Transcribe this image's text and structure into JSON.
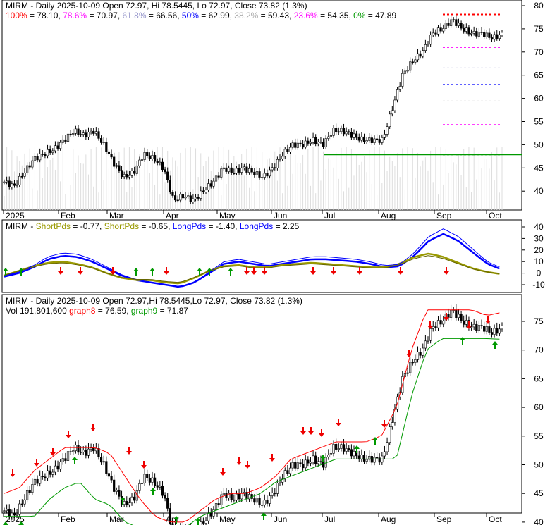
{
  "panel1": {
    "title": "MIRM - Daily 2025-10-09 Open 72.97, Hi 78.5445, Lo 72.97, Close 73.82 (1.3%)",
    "fibs": [
      {
        "label": "100%",
        "value": "78.10",
        "num": 78.1,
        "color": "#ff0000"
      },
      {
        "label": "78.6%",
        "value": "70.97",
        "num": 70.97,
        "color": "#ff00ff"
      },
      {
        "label": "61.8%",
        "value": "66.56",
        "num": 66.56,
        "color": "#9999cc"
      },
      {
        "label": "50%",
        "value": "62.99",
        "num": 62.99,
        "color": "#0000ff"
      },
      {
        "label": "38.2%",
        "value": "59.43",
        "num": 59.43,
        "color": "#aaaaaa"
      },
      {
        "label": "23.6%",
        "value": "54.35",
        "num": 54.35,
        "color": "#ff00ff"
      },
      {
        "label": "0%",
        "value": "47.89",
        "num": 47.89,
        "color": "#009900"
      }
    ]
  },
  "panel2": {
    "prefix": "MIRM - ",
    "items": [
      {
        "label": "ShortPds",
        "value": "-0.77",
        "color": "#999900"
      },
      {
        "label": "ShortPds",
        "value": "-0.65",
        "color": "#999900"
      },
      {
        "label": "LongPds",
        "value": "-1.40",
        "color": "#0000ff"
      },
      {
        "label": "LongPds",
        "value": "2.25",
        "color": "#0000ff"
      }
    ]
  },
  "panel3": {
    "title": "MIRM - Daily 2025-10-09 Open 72.97,Hi 78.5445,Lo 72.97, Close 73.82 (1.3%)",
    "vol": "Vol 191,801,600",
    "graph8_label": "graph8",
    "graph8_value": "76.59",
    "graph9_label": "graph9",
    "graph9_value": "71.87"
  },
  "chart_data": {
    "type": "candlestick",
    "x_ticks": [
      "2025",
      "Feb",
      "Mar",
      "Apr",
      "May",
      "Jun",
      "Jul",
      "Aug",
      "Sep",
      "Oct"
    ],
    "y_ticks_price": [
      40,
      45,
      50,
      55,
      60,
      65,
      70,
      75,
      80
    ],
    "y_ticks_osc": [
      -10,
      0,
      10,
      20,
      30,
      40
    ],
    "y_ticks_p3": [
      40,
      45,
      50,
      55,
      60,
      65,
      70,
      75
    ],
    "weekly_close": [
      42,
      41,
      44,
      47,
      48,
      49,
      51,
      53,
      52,
      53,
      50,
      46,
      43,
      44,
      48,
      47,
      45,
      38,
      39,
      38,
      40,
      42,
      45,
      44,
      45,
      44,
      43,
      45,
      48,
      50,
      50,
      51,
      50,
      53,
      53,
      52,
      51,
      51,
      51,
      58,
      65,
      68,
      70,
      74,
      75,
      77,
      75,
      74,
      74,
      73,
      73.82
    ],
    "osc_long": [
      -3,
      0,
      5,
      12,
      15,
      14,
      10,
      4,
      -2,
      -6,
      -8,
      -10,
      -12,
      -8,
      0,
      8,
      10,
      8,
      6,
      8,
      10,
      12,
      12,
      11,
      10,
      8,
      5,
      6,
      15,
      28,
      34,
      28,
      18,
      8,
      3
    ],
    "osc_short": [
      -2,
      2,
      6,
      9,
      10,
      8,
      5,
      0,
      -4,
      -6,
      -6,
      -8,
      -9,
      -4,
      2,
      6,
      7,
      5,
      5,
      7,
      8,
      9,
      8,
      7,
      6,
      5,
      5,
      8,
      14,
      17,
      14,
      9,
      4,
      1,
      -1
    ],
    "graph8": [
      45,
      46,
      49,
      51,
      53,
      53,
      53,
      52,
      48,
      44,
      41,
      40,
      40,
      42,
      44,
      45,
      45,
      46,
      48,
      51,
      52,
      53,
      54,
      54,
      54,
      55,
      60,
      70,
      77,
      77,
      77,
      77,
      76,
      76.59
    ],
    "graph9": [
      41,
      41,
      41,
      44,
      46,
      47,
      44,
      43,
      40,
      39,
      38,
      38,
      39,
      41,
      42,
      43,
      44,
      45,
      47,
      48,
      49,
      50,
      51,
      51,
      51,
      51,
      51,
      62,
      70,
      72,
      72,
      72,
      72,
      71.87
    ]
  }
}
